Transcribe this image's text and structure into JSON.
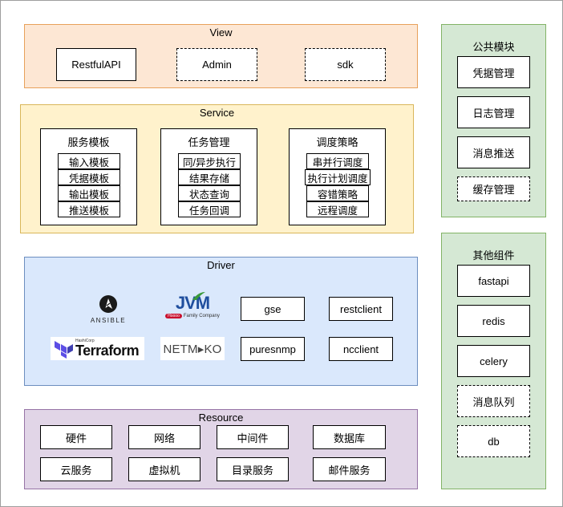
{
  "view": {
    "title": "View",
    "items": [
      "RestfulAPI",
      "Admin",
      "sdk"
    ]
  },
  "service": {
    "title": "Service",
    "groups": [
      {
        "title": "服务模板",
        "items": [
          "输入模板",
          "凭据模板",
          "输出模板",
          "推送模板"
        ]
      },
      {
        "title": "任务管理",
        "items": [
          "同/异步执行",
          "结果存储",
          "状态查询",
          "任务回调"
        ]
      },
      {
        "title": "调度策略",
        "items": [
          "串并行调度",
          "执行计划调度",
          "容错策略",
          "远程调度"
        ]
      }
    ]
  },
  "driver": {
    "title": "Driver",
    "logos": {
      "ansible": "ANSIBLE",
      "jvm": "JVM",
      "jvm_sub": "Family Company",
      "jvm_badge": "Hoooo",
      "terraform_small": "HashiCorp",
      "terraform": "Terraform",
      "netmiko": "NETM▸KO"
    },
    "items": [
      "gse",
      "restclient",
      "puresnmp",
      "ncclient"
    ]
  },
  "resource": {
    "title": "Resource",
    "items": [
      "硬件",
      "网络",
      "中间件",
      "数据库",
      "云服务",
      "虚拟机",
      "目录服务",
      "邮件服务"
    ]
  },
  "common": {
    "title": "公共模块",
    "items": [
      "凭据管理",
      "日志管理",
      "消息推送",
      "缓存管理"
    ]
  },
  "other": {
    "title": "其他组件",
    "items": [
      "fastapi",
      "redis",
      "celery",
      "消息队列",
      "db"
    ]
  },
  "colors": {
    "view_bg": "#fde7d4",
    "view_border": "#e8a15a",
    "service_bg": "#fff2cc",
    "service_border": "#d9b65a",
    "driver_bg": "#dae8fc",
    "driver_border": "#6c8ebf",
    "resource_bg": "#e1d5e7",
    "resource_border": "#9673a6",
    "side_bg": "#d5e8d4",
    "side_border": "#82b366",
    "terraform_purple": "#5c4ee5",
    "jvm_green": "#3a9a3a",
    "jvm_blue": "#1f4e9e"
  }
}
